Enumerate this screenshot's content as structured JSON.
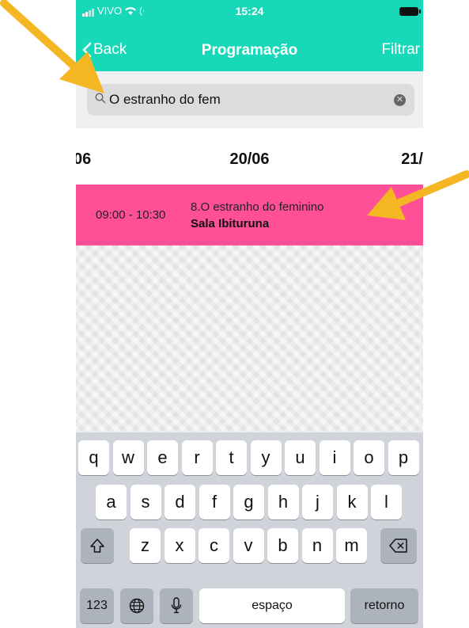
{
  "status_bar": {
    "carrier": "VIVO",
    "time": "15:24"
  },
  "nav": {
    "back_label": "Back",
    "title": "Programação",
    "filter_label": "Filtrar"
  },
  "search": {
    "value": "O estranho do fem",
    "clear_icon": "clear-circle-icon"
  },
  "dates": {
    "prev": "06",
    "current": "20/06",
    "next": "21/"
  },
  "event": {
    "time": "09:00 - 10:30",
    "title": "8.O estranho do feminino",
    "room": "Sala Ibituruna"
  },
  "keyboard": {
    "row1": [
      "q",
      "w",
      "e",
      "r",
      "t",
      "y",
      "u",
      "i",
      "o",
      "p"
    ],
    "row2": [
      "a",
      "s",
      "d",
      "f",
      "g",
      "h",
      "j",
      "k",
      "l"
    ],
    "row3": [
      "z",
      "x",
      "c",
      "v",
      "b",
      "n",
      "m"
    ],
    "numbers_label": "123",
    "space_label": "espaço",
    "return_label": "retorno"
  },
  "colors": {
    "accent": "#17d9b9",
    "event_bg": "#ff4f96",
    "arrow": "#f5b623"
  }
}
